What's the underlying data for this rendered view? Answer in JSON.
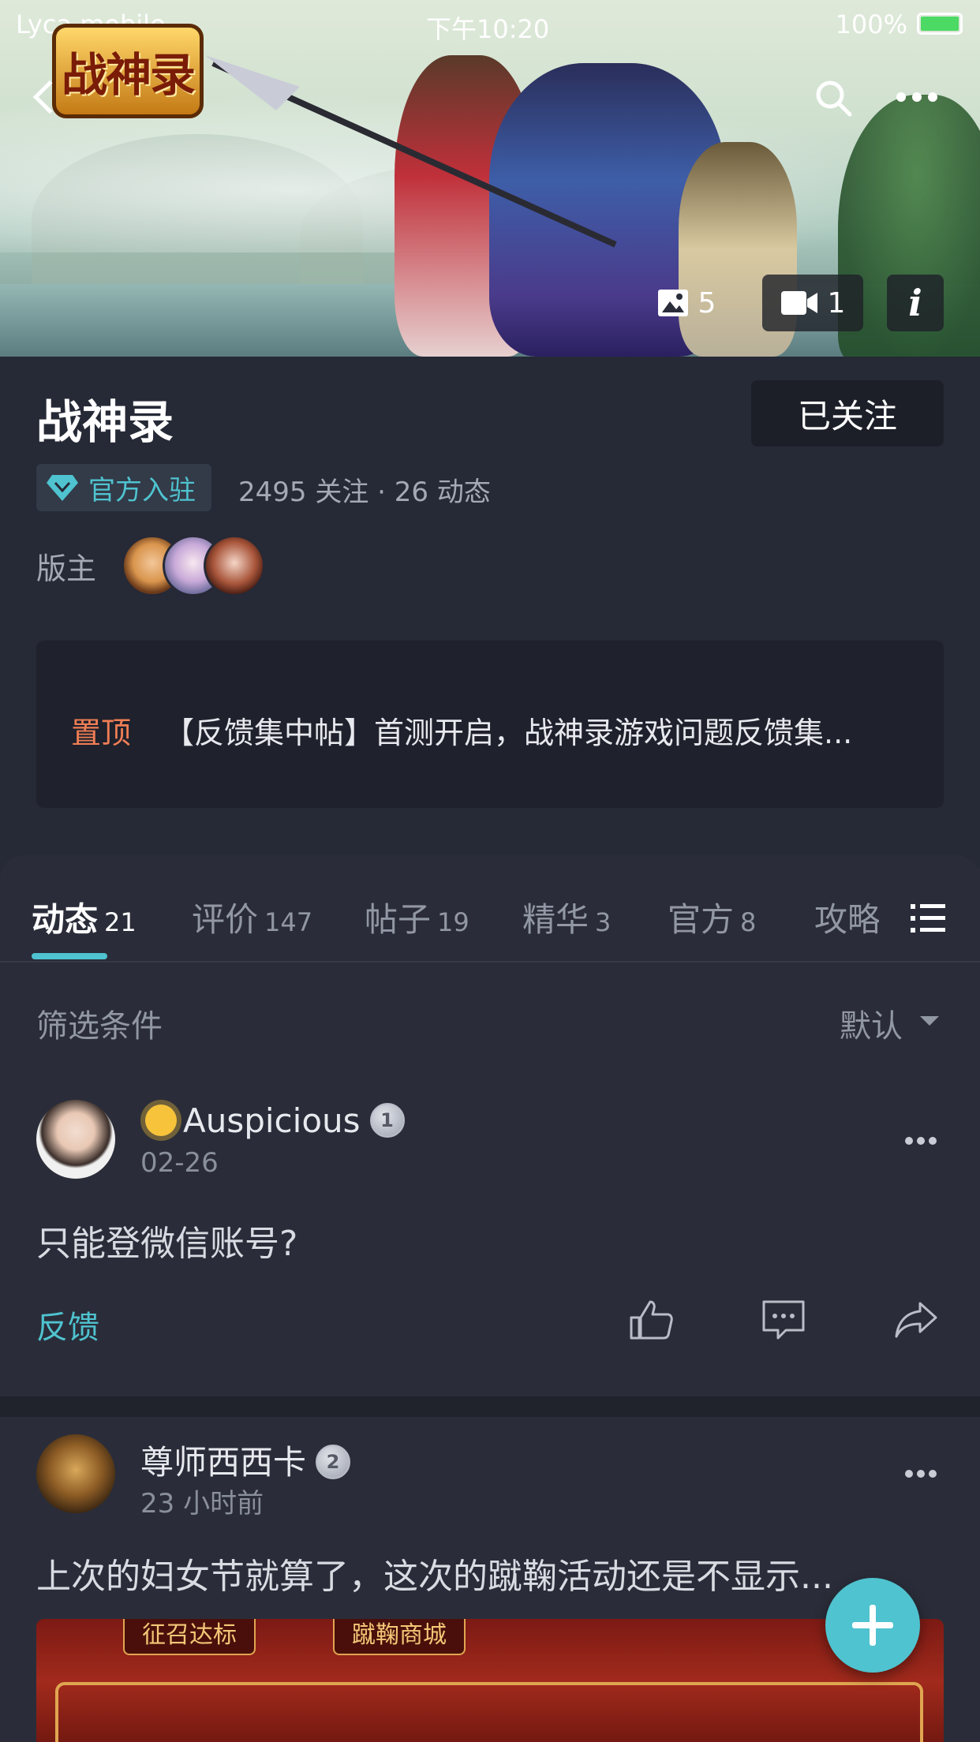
{
  "status_bar": {
    "carrier": "Lyca mobile",
    "time": "下午10:20",
    "battery": "100%"
  },
  "banner": {
    "logo_text": "战神录",
    "image_count": "5",
    "video_count": "1",
    "info_label": "i"
  },
  "header": {
    "title": "战神录",
    "follow_label": "已关注",
    "official_label": "官方入驻",
    "stats": "2495 关注 · 26 动态",
    "moderator_label": "版主"
  },
  "pinned": {
    "tag": "置顶",
    "text": "【反馈集中帖】首测开启，战神录游戏问题反馈集..."
  },
  "tabs": [
    {
      "label": "动态",
      "count": "21"
    },
    {
      "label": "评价",
      "count": "147"
    },
    {
      "label": "帖子",
      "count": "19"
    },
    {
      "label": "精华",
      "count": "3"
    },
    {
      "label": "官方",
      "count": "8"
    },
    {
      "label": "攻略",
      "count": ""
    }
  ],
  "filter": {
    "label": "筛选条件",
    "sort": "默认"
  },
  "posts": [
    {
      "author": "Auspicious",
      "level": "1",
      "time": "02-26",
      "body": "只能登微信账号?",
      "tag": "反馈"
    },
    {
      "author": "尊师西西卡",
      "level": "2",
      "time": "23 小时前",
      "body": "上次的妇女节就算了，这次的蹴鞠活动还是不显示...",
      "image_chips": [
        "征召达标",
        "蹴鞠商城"
      ]
    }
  ],
  "colors": {
    "accent": "#4fc3cf",
    "pinned_tag": "#f07e55",
    "background": "#262936"
  }
}
